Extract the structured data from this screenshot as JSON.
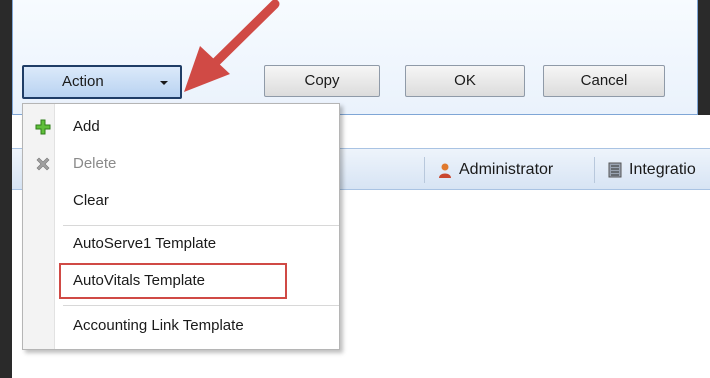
{
  "dialog": {
    "action_label": "Action",
    "copy_label": "Copy",
    "ok_label": "OK",
    "cancel_label": "Cancel"
  },
  "toolbar": {
    "administrator_label": "Administrator",
    "integration_label": "Integratio"
  },
  "menu": {
    "items": [
      {
        "label": "Add",
        "icon": "plus-icon",
        "enabled": true
      },
      {
        "label": "Delete",
        "icon": "delete-icon",
        "enabled": false
      },
      {
        "label": "Clear",
        "icon": "",
        "enabled": true
      },
      {
        "label": "AutoServe1 Template",
        "icon": "",
        "enabled": true
      },
      {
        "label": "AutoVitals Template",
        "icon": "",
        "enabled": true,
        "highlighted": true
      },
      {
        "label": "Accounting Link Template",
        "icon": "",
        "enabled": true
      }
    ]
  },
  "colors": {
    "annotation_red": "#d04a45",
    "accent_blue": "#7fa6d6"
  }
}
